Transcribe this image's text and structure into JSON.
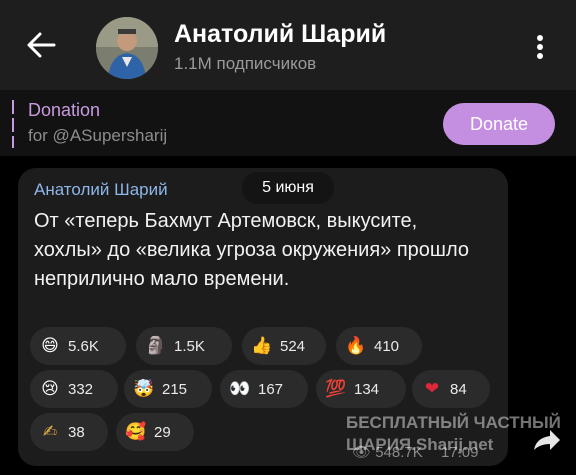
{
  "header": {
    "title": "Анатолий Шарий",
    "subscribers": "1.1M подписчиков"
  },
  "pinned": {
    "title": "Donation",
    "subtitle": "for @ASupersharij",
    "button_label": "Donate"
  },
  "message": {
    "author": "Анатолий Шарий",
    "date": "5 июня",
    "text": "От «теперь Бахмут Артемовск, выкусите, хохлы» до «велика угроза окружения» прошло неприлично мало времени.",
    "views": "548.7K",
    "time": "17:09"
  },
  "reactions": [
    {
      "icon": "grinning-face",
      "glyph": "😄",
      "count": "5.6K"
    },
    {
      "icon": "moai",
      "glyph": "🗿",
      "count": "1.5K"
    },
    {
      "icon": "thumbs-up",
      "glyph": "👍",
      "count": "524"
    },
    {
      "icon": "fire",
      "glyph": "🔥",
      "count": "410"
    },
    {
      "icon": "crying-face",
      "glyph": "😢",
      "count": "332"
    },
    {
      "icon": "exploding-head",
      "glyph": "🤯",
      "count": "215"
    },
    {
      "icon": "eyes",
      "glyph": "👀",
      "count": "167"
    },
    {
      "icon": "hundred-points",
      "glyph": "💯",
      "count": "134"
    },
    {
      "icon": "red-heart",
      "glyph": "❤",
      "count": "84"
    },
    {
      "icon": "writing-hand",
      "glyph": "✍",
      "count": "38"
    },
    {
      "icon": "smiling-hearts",
      "glyph": "🥰",
      "count": "29"
    }
  ],
  "watermark": {
    "line1": "БЕСПЛАТНЫЙ  ЧАСТНЫЙ",
    "line2": "ШАРИЯ.Sharij.net"
  },
  "colors": {
    "accent": "#c58fe1",
    "author": "#8fb6e8",
    "bubble": "#1c1c1c"
  }
}
